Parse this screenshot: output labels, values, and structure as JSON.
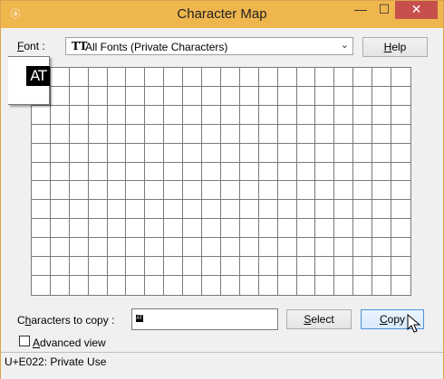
{
  "window": {
    "title": "Character Map",
    "app_icon": "character-map-icon",
    "minimize_glyph": "—",
    "maximize_glyph": "☐",
    "close_glyph": "✕"
  },
  "font": {
    "label": "Font :",
    "label_access_key": "F",
    "selected": "All Fonts (Private Characters)",
    "icon": "TT"
  },
  "help_button": {
    "label": "Help",
    "access_key": "H"
  },
  "character_grid": {
    "columns": 20,
    "rows": 12,
    "preview_glyph": "AT"
  },
  "copy": {
    "label": "Characters to copy :",
    "access_key": "h",
    "value_glyph": "AT",
    "select_label": "Select",
    "copy_label": "Copy"
  },
  "advanced_view": {
    "label": "Advanced view",
    "checked": false
  },
  "status": {
    "text": "U+E022: Private Use"
  }
}
